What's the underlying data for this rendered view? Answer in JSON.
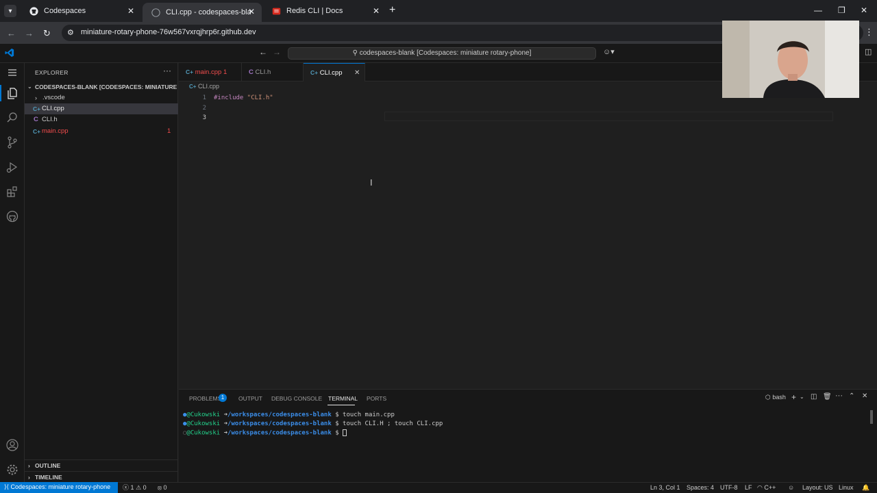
{
  "browser": {
    "tabs": [
      {
        "title": "Codespaces"
      },
      {
        "title": "CLI.cpp - codespaces-blank [Co"
      },
      {
        "title": "Redis CLI | Docs"
      }
    ],
    "url": "miniature-rotary-phone-76w567vxrqjhrp6r.github.dev"
  },
  "titlebar": {
    "command_center": "codespaces-blank [Codespaces: miniature rotary-phone]"
  },
  "sidebar": {
    "title": "EXPLORER",
    "root": "CODESPACES-BLANK [CODESPACES: MINIATURE RO...",
    "items": [
      {
        "label": ".vscode",
        "icon": "chevron-right-icon"
      },
      {
        "label": "CLI.cpp",
        "icon": "cpp-file-icon"
      },
      {
        "label": "CLI.h",
        "icon": "c-header-icon"
      },
      {
        "label": "main.cpp",
        "icon": "cpp-file-icon",
        "badge": "1"
      }
    ],
    "outline": "OUTLINE",
    "timeline": "TIMELINE"
  },
  "editor": {
    "tabs": [
      {
        "label": "main.cpp",
        "badge": "1"
      },
      {
        "label": "CLI.h"
      },
      {
        "label": "CLI.cpp"
      }
    ],
    "breadcrumb": "CLI.cpp",
    "lines": [
      {
        "num": "1",
        "directive": "#include",
        "string": "\"CLI.h\""
      },
      {
        "num": "2"
      },
      {
        "num": "3"
      }
    ]
  },
  "panel": {
    "tabs": [
      "PROBLEMS",
      "OUTPUT",
      "DEBUG CONSOLE",
      "TERMINAL",
      "PORTS"
    ],
    "problems_count": "1",
    "shell": "bash",
    "terminal": [
      {
        "user": "@Cukowski",
        "arrow": "➜",
        "path": "/workspaces/codespaces-blank",
        "cmd": "$ touch main.cpp"
      },
      {
        "user": "@Cukowski",
        "arrow": "➜",
        "path": "/workspaces/codespaces-blank",
        "cmd": "$ touch CLI.H ; touch CLI.cpp"
      },
      {
        "user": "@Cukowski",
        "arrow": "➜",
        "path": "/workspaces/codespaces-blank",
        "cmd": "$ "
      }
    ]
  },
  "statusbar": {
    "remote": "Codespaces: miniature rotary-phone",
    "errors": "1",
    "warnings": "0",
    "ports": "0",
    "position": "Ln 3, Col 1",
    "spaces": "Spaces: 4",
    "encoding": "UTF-8",
    "eol": "LF",
    "language": "C++",
    "layout": "Layout: US",
    "os": "Linux"
  },
  "colors": {
    "accent": "#0078d4",
    "error_file": "#f14c4c",
    "cpp_icon": "#519aba",
    "c_icon": "#a074c4",
    "term_user": "#23d18b",
    "term_path": "#3b8eea",
    "directive": "#c586c0",
    "string": "#ce9178"
  }
}
